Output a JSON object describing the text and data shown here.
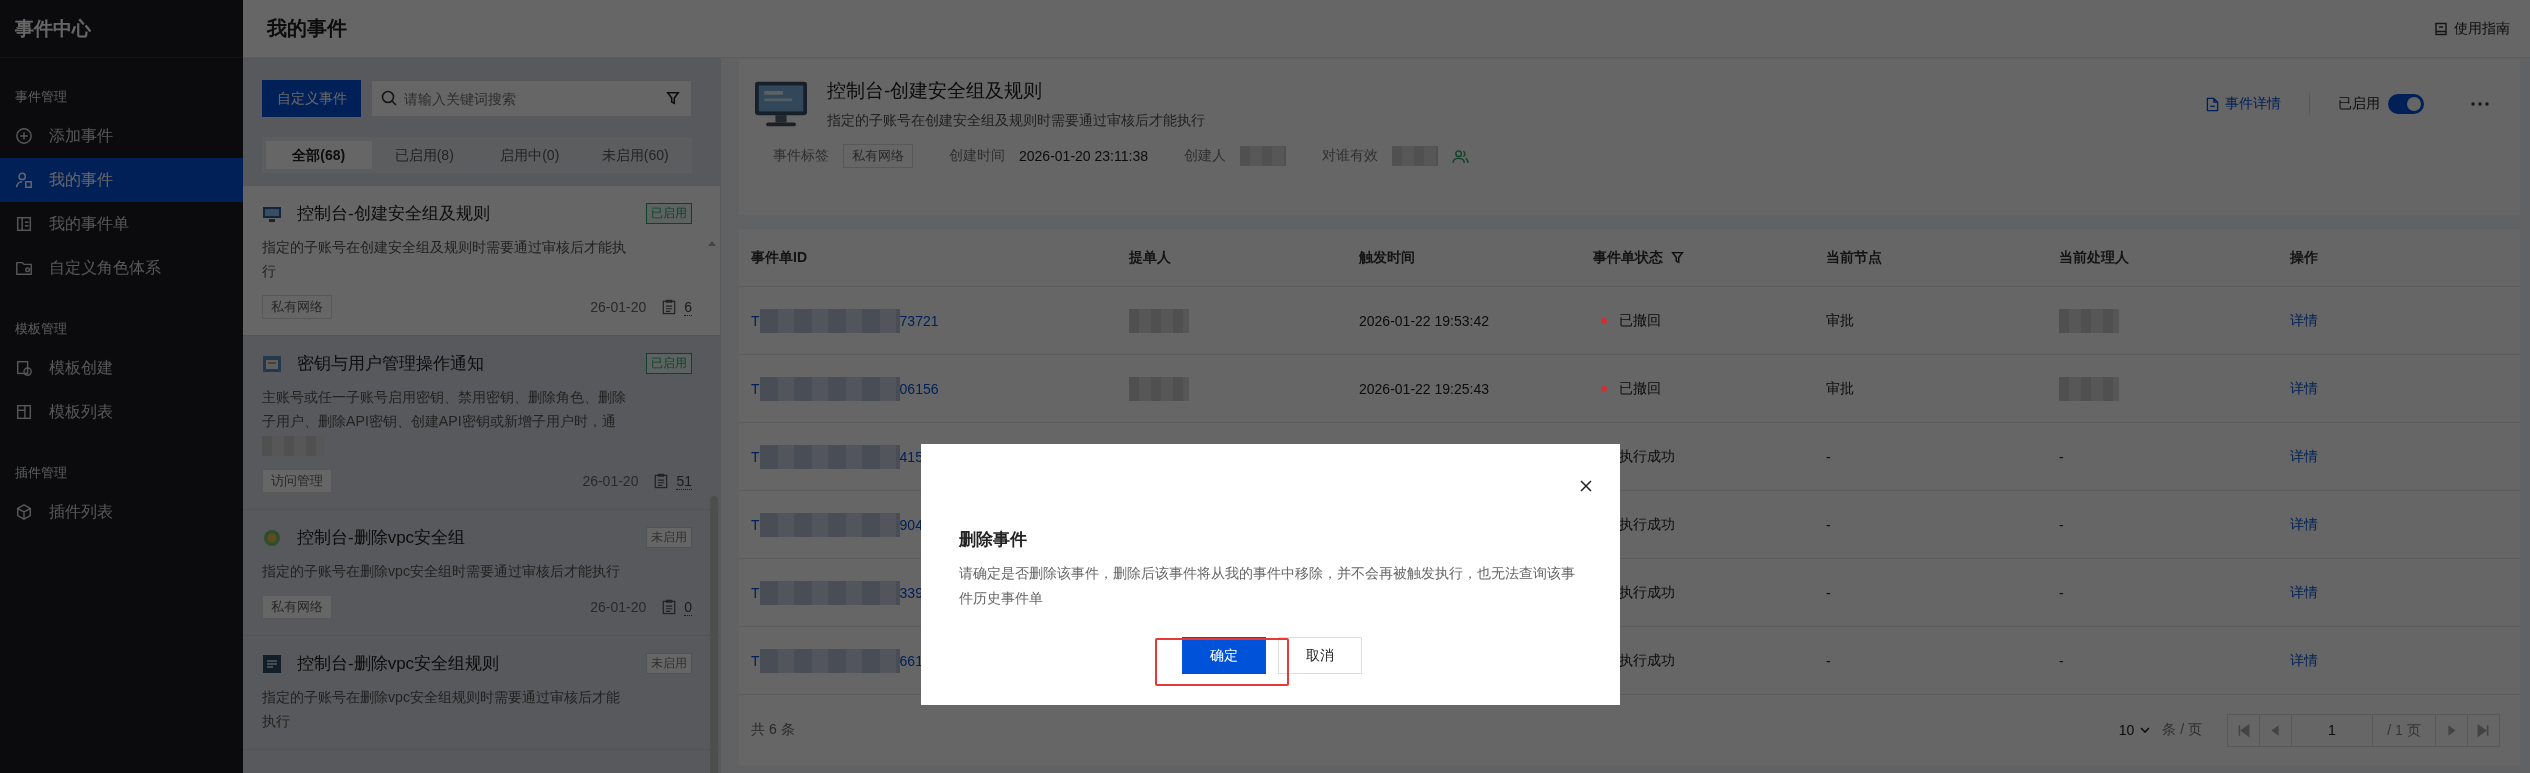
{
  "sidebar": {
    "title": "事件中心",
    "sections": [
      {
        "heading": "事件管理",
        "items": [
          {
            "label": "添加事件",
            "selected": false
          },
          {
            "label": "我的事件",
            "selected": true
          },
          {
            "label": "我的事件单",
            "selected": false
          },
          {
            "label": "自定义角色体系",
            "selected": false
          }
        ]
      },
      {
        "heading": "模板管理",
        "items": [
          {
            "label": "模板创建",
            "selected": false
          },
          {
            "label": "模板列表",
            "selected": false
          }
        ]
      },
      {
        "heading": "插件管理",
        "items": [
          {
            "label": "插件列表",
            "selected": false
          }
        ]
      }
    ]
  },
  "header": {
    "title": "我的事件",
    "guide_link": "使用指南"
  },
  "event_list": {
    "create_button": "自定义事件",
    "search": {
      "placeholder": "请输入关键词搜索"
    },
    "tabs": [
      {
        "label": "全部(68)",
        "selected": true
      },
      {
        "label": "已启用(8)",
        "selected": false
      },
      {
        "label": "启用中(0)",
        "selected": false
      },
      {
        "label": "未启用(60)",
        "selected": false
      }
    ],
    "items": [
      {
        "title": "控制台-创建安全组及规则",
        "enabled": true,
        "status_label": "已启用",
        "description": "指定的子账号在创建安全组及规则时需要通过审核后才能执行",
        "redacted_tail": false,
        "tag": "私有网络",
        "date": "26-01-20",
        "count": "6",
        "selected": true
      },
      {
        "title": "密钥与用户管理操作通知",
        "enabled": true,
        "status_label": "已启用",
        "description": "主账号或任一子账号启用密钥、禁用密钥、删除角色、删除子用户、删除API密钥、创建API密钥或新增子用户时，通",
        "redacted_tail": true,
        "tag": "访问管理",
        "date": "26-01-20",
        "count": "51",
        "selected": false
      },
      {
        "title": "控制台-删除vpc安全组",
        "enabled": false,
        "status_label": "未启用",
        "description": "指定的子账号在删除vpc安全组时需要通过审核后才能执行",
        "redacted_tail": false,
        "tag": "私有网络",
        "date": "26-01-20",
        "count": "0",
        "selected": false
      },
      {
        "title": "控制台-删除vpc安全组规则",
        "enabled": false,
        "status_label": "未启用",
        "description": "指定的子账号在删除vpc安全组规则时需要通过审核后才能执行",
        "redacted_tail": false,
        "selected": false
      }
    ]
  },
  "detail": {
    "title": "控制台-创建安全组及规则",
    "description": "指定的子账号在创建安全组及规则时需要通过审核后才能执行",
    "meta": [
      {
        "kind": "tag",
        "label": "事件标签",
        "value": "私有网络"
      },
      {
        "kind": "text",
        "label": "创建时间",
        "value": "2026-01-20 23:11:38"
      },
      {
        "kind": "redacted",
        "label": "创建人"
      },
      {
        "kind": "users",
        "label": "对谁有效"
      }
    ],
    "detail_link": "事件详情",
    "enabled_label": "已启用",
    "enabled": true
  },
  "table": {
    "columns": [
      {
        "label": "事件单ID",
        "filter": false
      },
      {
        "label": "提单人",
        "filter": false
      },
      {
        "label": "触发时间",
        "filter": false
      },
      {
        "label": "事件单状态",
        "filter": true
      },
      {
        "label": "当前节点",
        "filter": false
      },
      {
        "label": "当前处理人",
        "filter": false
      },
      {
        "label": "操作",
        "filter": false
      }
    ],
    "rows": [
      {
        "id_start": "T",
        "id_end": "73721",
        "time": "2026-01-22 19:53:42",
        "status": "已撤回",
        "color": "#d42f2f",
        "node": "审批",
        "action": "详情"
      },
      {
        "id_start": "T",
        "id_end": "06156",
        "time": "2026-01-22 19:25:43",
        "status": "已撤回",
        "color": "#d42f2f",
        "node": "审批",
        "action": "详情"
      },
      {
        "id_start": "T",
        "id_end": "415",
        "status": "执行成功",
        "node": "-",
        "handler": "-",
        "action": "详情"
      },
      {
        "id_start": "T",
        "id_end": "904",
        "status": "执行成功",
        "node": "-",
        "handler": "-",
        "action": "详情"
      },
      {
        "id_start": "T",
        "id_end": "339",
        "status": "执行成功",
        "node": "-",
        "handler": "-",
        "action": "详情"
      },
      {
        "id_start": "T",
        "id_end": "661",
        "status": "执行成功",
        "node": "-",
        "handler": "-",
        "action": "详情"
      }
    ],
    "total": "共 6 条",
    "pager": {
      "page_size": "10",
      "per_page": "条 / 页",
      "page": "1",
      "page_total": "/ 1 页"
    }
  },
  "dialog": {
    "title": "删除事件",
    "message": "请确定是否删除该事件，删除后该事件将从我的事件中移除，并不会再被触发执行，也无法查询该事件历史事件单",
    "confirm": "确定",
    "cancel": "取消",
    "highlight_confirm": true
  }
}
